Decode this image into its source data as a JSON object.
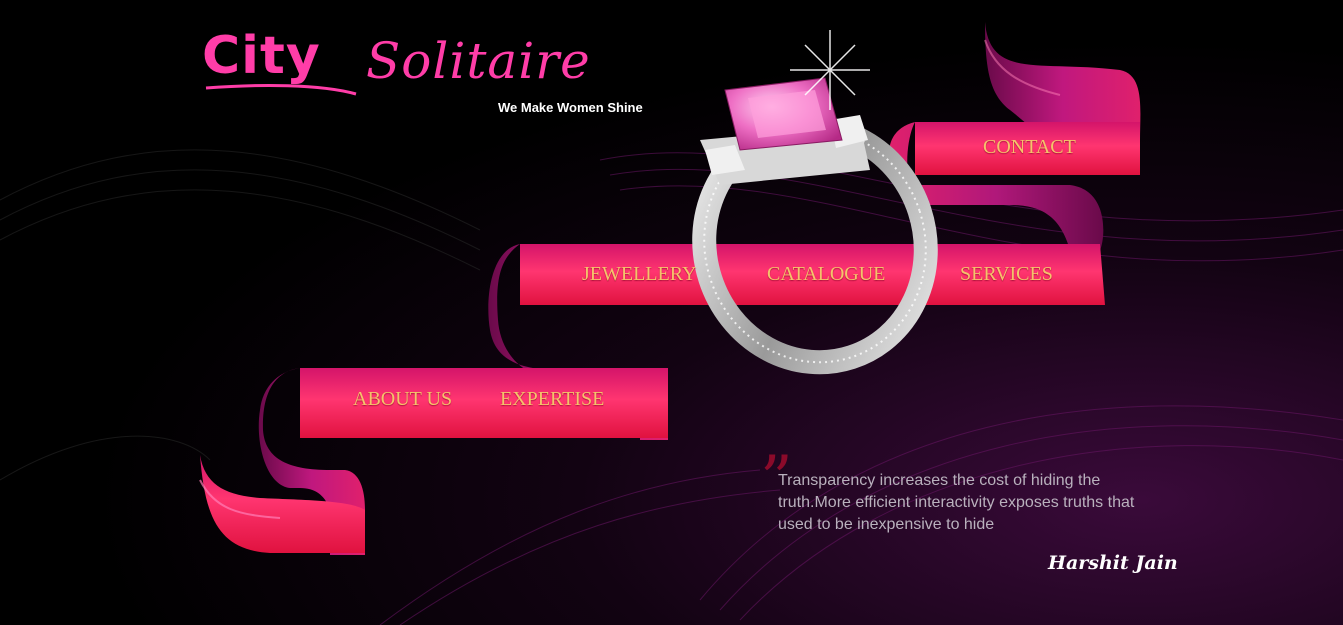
{
  "brand": {
    "name_part1": "City",
    "name_part2": "Solitaire",
    "tagline": "We Make Women Shine"
  },
  "nav": {
    "contact": "CONTACT",
    "jewellery": "JEWELLERY",
    "catalogue": "CATALOGUE",
    "services": "SERVICES",
    "about_us": "ABOUT US",
    "expertise": "EXPERTISE"
  },
  "quote": {
    "mark": "”",
    "text": "Transparency increases the cost of hiding the truth.More efficient interactivity exposes truths that used to be inexpensive to hide",
    "author": "Harshit Jain"
  },
  "colors": {
    "brand_pink": "#ff3da8",
    "nav_text": "#f4c36b",
    "ribbon_red": "#ff2a5a",
    "ribbon_magenta": "#c0187e",
    "background": "#000000"
  },
  "icons": {
    "ring_image": "pink-diamond-ring-icon",
    "quote_icon": "quote-mark-icon"
  }
}
